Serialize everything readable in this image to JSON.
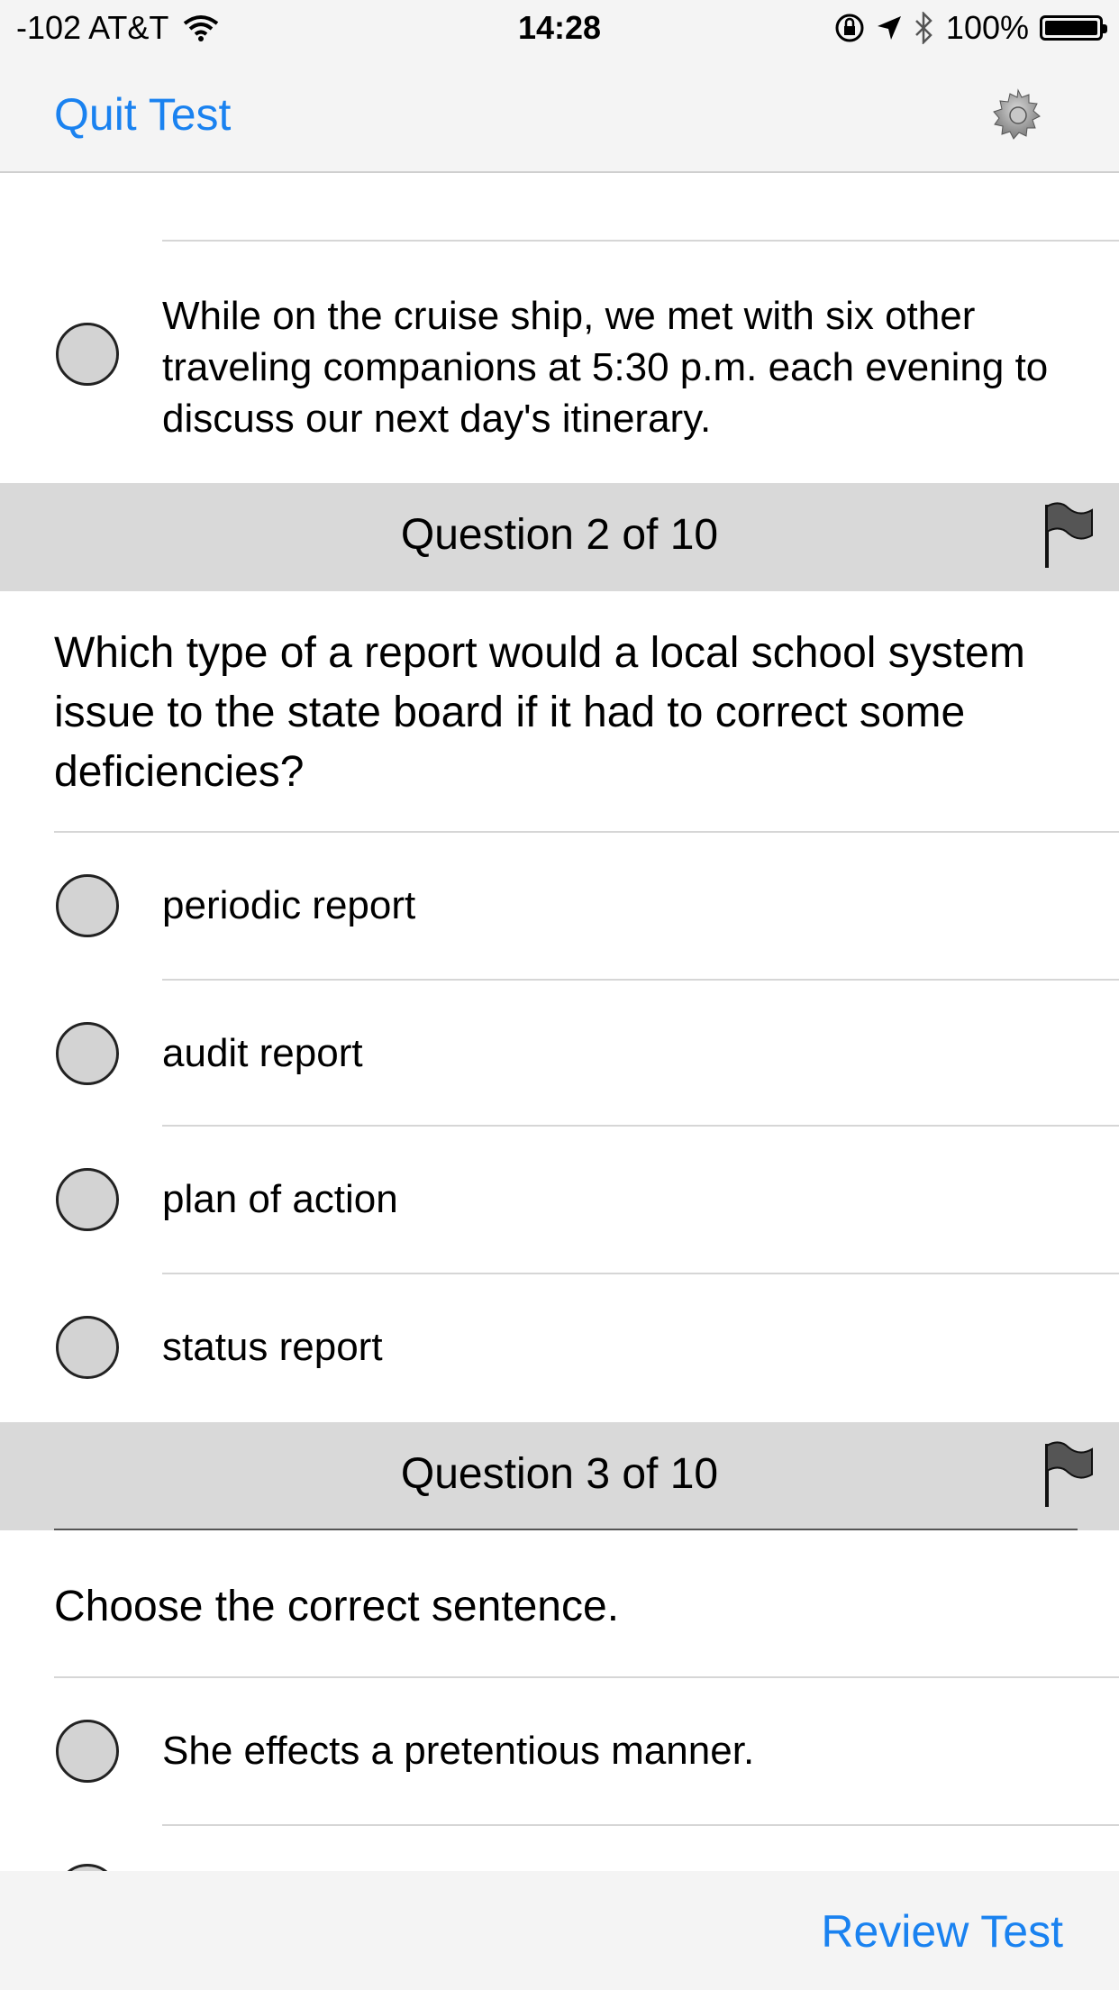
{
  "status_bar": {
    "signal": "-102 AT&T",
    "time": "14:28",
    "battery": "100%"
  },
  "nav": {
    "quit_label": "Quit Test",
    "settings_icon": "gear-icon"
  },
  "questions": [
    {
      "options": [
        "While on the cruise ship, we met with six other traveling companions at 5:30 p.m. each evening to discuss our next day's itinerary."
      ]
    },
    {
      "header": "Question 2 of 10",
      "text": "Which type of a report would a local school system issue to the state board if it had to correct some deficiencies?",
      "options": [
        "periodic report",
        "audit report",
        "plan of action",
        "status report"
      ]
    },
    {
      "header": "Question 3 of 10",
      "text": "Choose the correct sentence.",
      "options": [
        "She effects a pretentious manner."
      ]
    }
  ],
  "toolbar": {
    "review_label": "Review Test"
  },
  "colors": {
    "accent": "#1a82f0",
    "header_bg": "#d9d9d9",
    "bar_bg": "#f4f4f4"
  }
}
